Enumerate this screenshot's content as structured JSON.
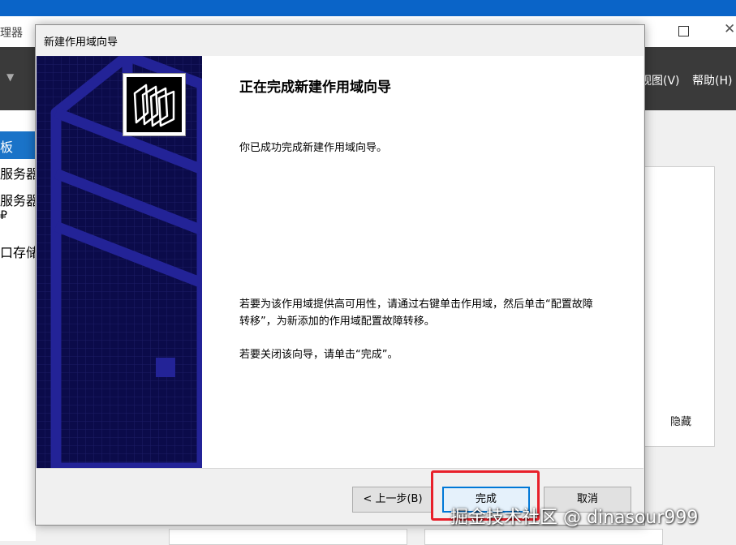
{
  "background_app": {
    "title": "理器",
    "menu": [
      "视图(V)",
      "帮助(H)"
    ],
    "left_items": [
      "板",
      "服务器",
      "服务器",
      "₽",
      "口存储"
    ],
    "right_panel_link": "隐藏"
  },
  "dialog": {
    "title": "新建作用域向导",
    "heading": "正在完成新建作用域向导",
    "success_text": "你已成功完成新建作用域向导。",
    "ha_text": "若要为该作用域提供高可用性，请通过右键单击作用域，然后单击“配置故障转移”，为新添加的作用域配置故障转移。",
    "close_text": "若要关闭该向导，请单击“完成”。",
    "buttons": {
      "prev": "< 上一步(B)",
      "finish": "完成",
      "cancel": "取消"
    },
    "banner_icon": "folders-icon"
  },
  "watermark": "掘金技术社区 @ dinasour999",
  "colors": {
    "banner": "#0b0b4a",
    "highlight": "#e8202a",
    "selection": "#1a73c8"
  }
}
